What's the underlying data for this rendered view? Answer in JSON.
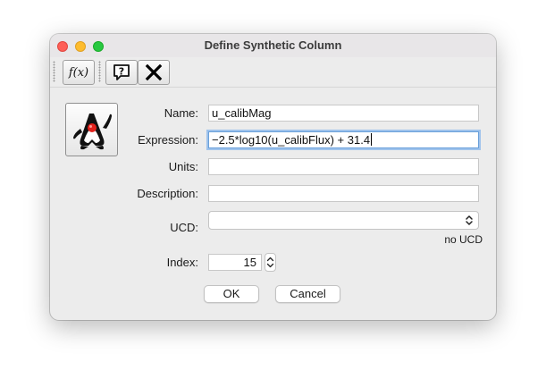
{
  "window": {
    "title": "Define Synthetic Column"
  },
  "toolbar": {
    "function_label": "f(x)"
  },
  "form": {
    "name_label": "Name:",
    "name_value": "u_calibMag",
    "expression_label": "Expression:",
    "expression_value": "−2.5*log10(u_calibFlux) + 31.4",
    "units_label": "Units:",
    "units_value": "",
    "description_label": "Description:",
    "description_value": "",
    "ucd_label": "UCD:",
    "ucd_value": "",
    "ucd_status": "no UCD",
    "index_label": "Index:",
    "index_value": "15"
  },
  "buttons": {
    "ok_label": "OK",
    "cancel_label": "Cancel"
  },
  "colors": {
    "close": "#fe5f57",
    "minimize": "#febc2e",
    "maximize": "#28c840",
    "focus_ring": "#9fc3ec"
  }
}
